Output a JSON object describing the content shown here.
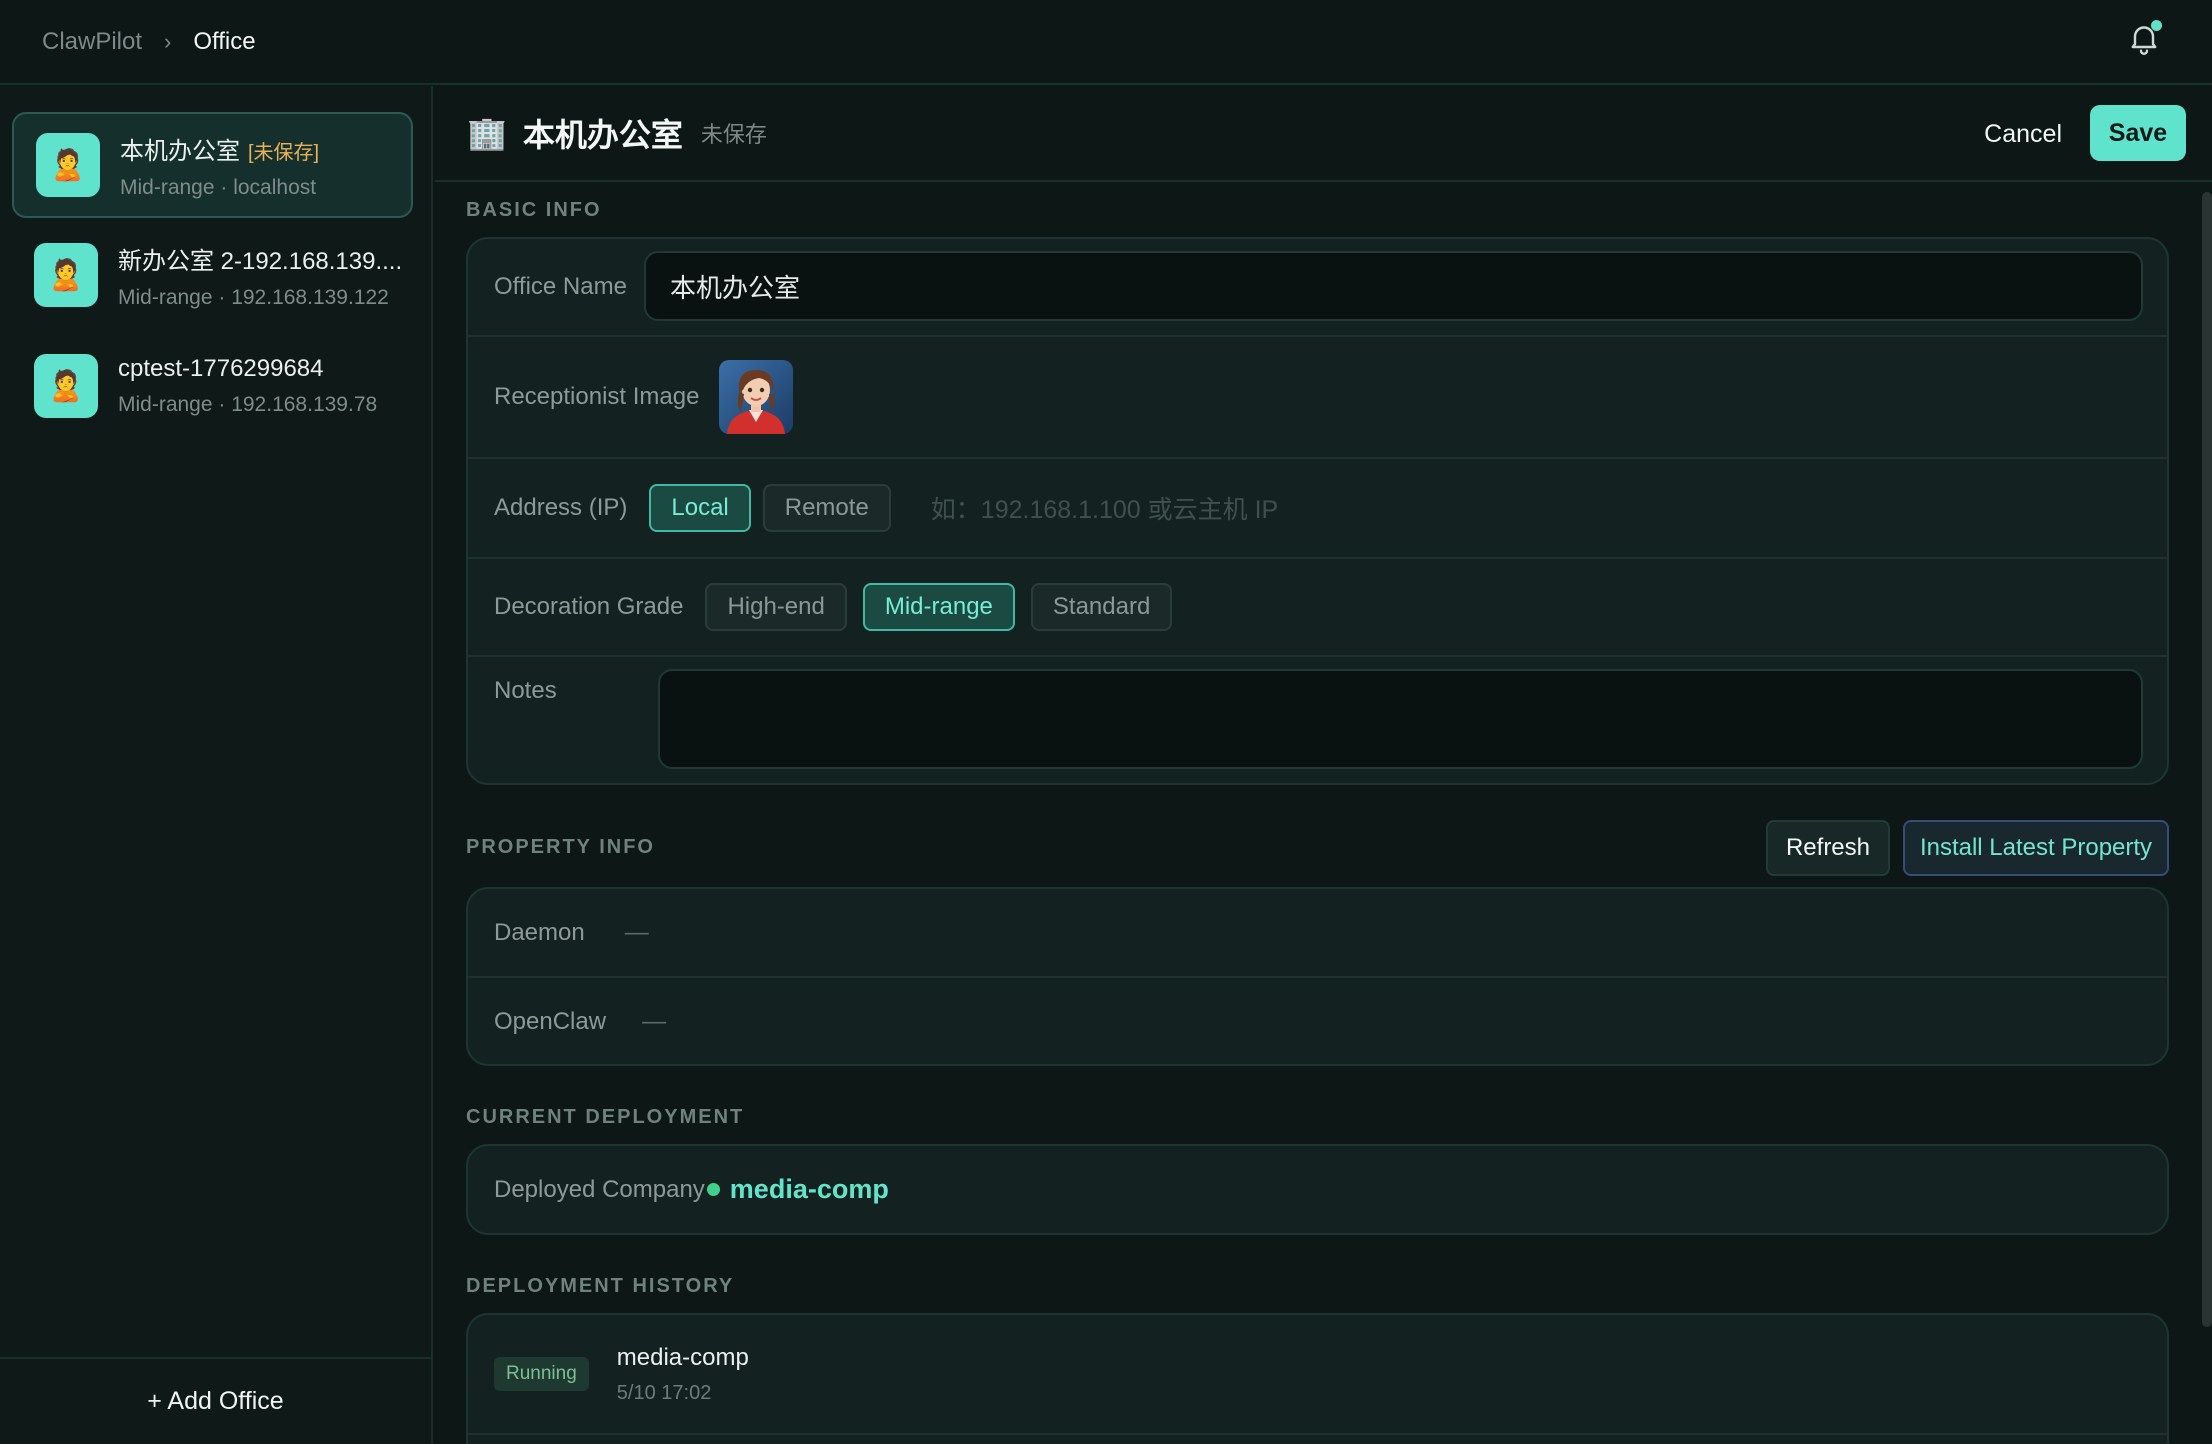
{
  "breadcrumb": {
    "root": "ClawPilot",
    "current": "Office"
  },
  "sidebar": {
    "offices": [
      {
        "name": "本机办公室",
        "tag": "[未保存]",
        "sub": "Mid-range · localhost",
        "avatar": "🙎"
      },
      {
        "name": "新办公室 2-192.168.139....",
        "tag": "",
        "sub": "Mid-range · 192.168.139.122",
        "avatar": "🙎"
      },
      {
        "name": "cptest-1776299684",
        "tag": "",
        "sub": "Mid-range · 192.168.139.78",
        "avatar": "🙎"
      }
    ],
    "add_label": "+ Add Office"
  },
  "header": {
    "icon": "🏢",
    "title": "本机办公室",
    "status": "未保存",
    "cancel_label": "Cancel",
    "save_label": "Save"
  },
  "basic_info": {
    "section_title": "BASIC INFO",
    "office_name_label": "Office Name",
    "office_name_value": "本机办公室",
    "receptionist_label": "Receptionist Image",
    "address_label": "Address (IP)",
    "address_options": [
      "Local",
      "Remote"
    ],
    "address_selected": "Local",
    "ip_placeholder": "如：192.168.1.100 或云主机 IP",
    "grade_label": "Decoration Grade",
    "grade_options": [
      "High-end",
      "Mid-range",
      "Standard"
    ],
    "grade_selected": "Mid-range",
    "notes_label": "Notes",
    "notes_value": ""
  },
  "property_info": {
    "section_title": "PROPERTY INFO",
    "refresh_label": "Refresh",
    "install_label": "Install Latest Property",
    "rows": [
      {
        "label": "Daemon",
        "value": "—"
      },
      {
        "label": "OpenClaw",
        "value": "—"
      }
    ]
  },
  "current_deployment": {
    "section_title": "CURRENT DEPLOYMENT",
    "label": "Deployed Company",
    "company": "media-comp"
  },
  "deployment_history": {
    "section_title": "DEPLOYMENT HISTORY",
    "items": [
      {
        "status": "Running",
        "name": "media-comp",
        "time": "5/10 17:02"
      }
    ]
  },
  "colors": {
    "accent": "#5fe3cd",
    "warning": "#e7b25a",
    "background": "#0c1716"
  }
}
